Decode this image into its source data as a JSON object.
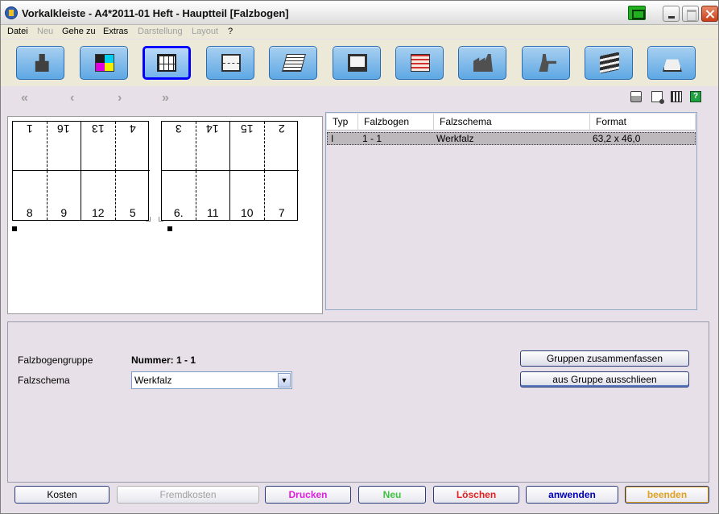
{
  "window": {
    "title": "Vorkalkleiste - A4*2011-01 Heft - Hauptteil [Falzbogen]",
    "title_icon": "app-icon",
    "controls": [
      "minimize-icon",
      "maximize-icon",
      "close-icon"
    ]
  },
  "menu": {
    "items": [
      {
        "label": "Datei",
        "enabled": true
      },
      {
        "label": "Neu",
        "enabled": false
      },
      {
        "label": "Gehe zu",
        "enabled": true
      },
      {
        "label": "Extras",
        "enabled": true
      },
      {
        "label": "Darstellung",
        "enabled": false
      },
      {
        "label": "Layout",
        "enabled": false
      },
      {
        "label": "?",
        "enabled": true
      }
    ]
  },
  "toolbar": {
    "buttons": [
      {
        "icon": "person-at-desk-icon"
      },
      {
        "icon": "cmyk-color-icon"
      },
      {
        "icon": "grid-layout-icon",
        "active": true
      },
      {
        "icon": "sheet-icon"
      },
      {
        "icon": "paper-stack-icon"
      },
      {
        "icon": "monitor-icon"
      },
      {
        "icon": "list-icon"
      },
      {
        "icon": "factory-icon"
      },
      {
        "icon": "worker-icon"
      },
      {
        "icon": "books-icon"
      },
      {
        "icon": "box-icon"
      }
    ]
  },
  "nav": {
    "first": "«",
    "prev": "‹",
    "next": "›",
    "last": "»",
    "right_icons": [
      "printer-icon",
      "document-icon",
      "calculator-icon",
      "help-icon"
    ],
    "help_glyph": "?"
  },
  "imposition": {
    "sheet_a": {
      "top": [
        "1",
        "16",
        "13",
        "4"
      ],
      "bottom": [
        "8",
        "9",
        "12",
        "5"
      ]
    },
    "sheet_b": {
      "top": [
        "3",
        "14",
        "15",
        "2"
      ],
      "bottom": [
        "6.",
        "11",
        "10",
        "7"
      ]
    }
  },
  "table": {
    "columns": [
      "Typ",
      "Falzbogen",
      "Falzschema",
      "Format"
    ],
    "rows": [
      {
        "typ": "I",
        "falzbogen": "1 - 1",
        "falzschema": "Werkfalz",
        "format": "63,2 x 46,0"
      }
    ]
  },
  "details": {
    "group_label": "Falzbogengruppe",
    "group_value": "Nummer: 1 - 1",
    "schema_label": "Falzschema",
    "schema_value": "Werkfalz",
    "btn_group": "Gruppen zusammenfassen",
    "btn_exclude": "aus Gruppe ausschlieen"
  },
  "bottom": {
    "buttons": [
      {
        "label": "Kosten",
        "color": "#000000",
        "enabled": true
      },
      {
        "label": "Fremdkosten",
        "color": "#a0a0a0",
        "enabled": false
      },
      {
        "label": "Drucken",
        "color": "#e020e0",
        "enabled": true
      },
      {
        "label": "Neu",
        "color": "#40c040",
        "enabled": true
      },
      {
        "label": "Löschen",
        "color": "#e02020",
        "enabled": true
      },
      {
        "label": "anwenden",
        "color": "#0000c0",
        "enabled": true
      },
      {
        "label": "beenden",
        "color": "#e0a020",
        "enabled": true
      }
    ]
  }
}
